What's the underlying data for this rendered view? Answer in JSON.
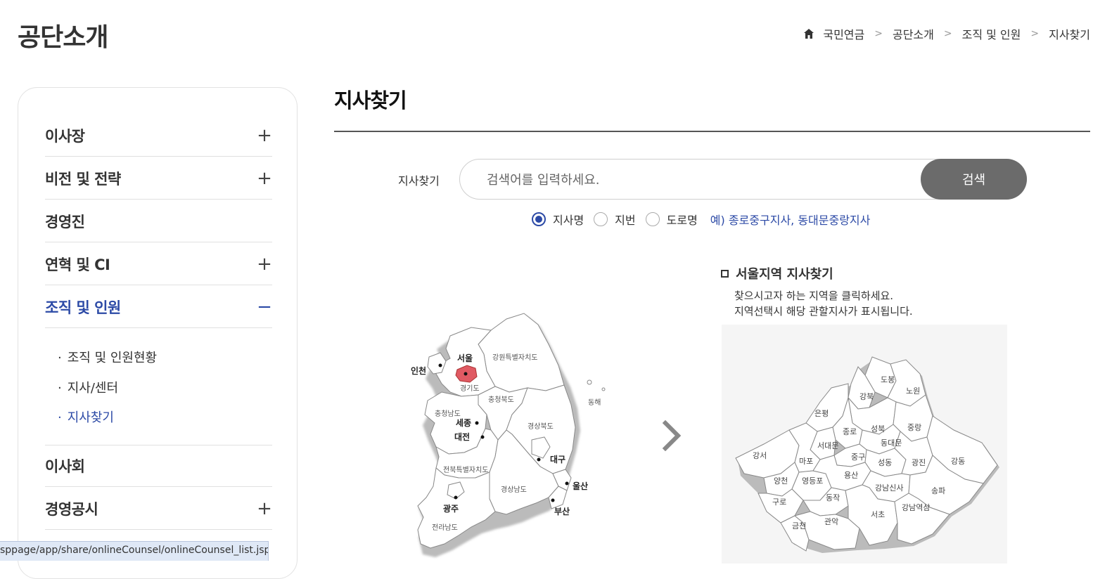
{
  "header": {
    "title": "공단소개",
    "breadcrumb": [
      "국민연금",
      "공단소개",
      "조직 및 인원",
      "지사찾기"
    ]
  },
  "sidebar": {
    "items": [
      {
        "label": "이사장",
        "toggle": "+"
      },
      {
        "label": "비전 및 전략",
        "toggle": "+"
      },
      {
        "label": "경영진",
        "toggle": ""
      },
      {
        "label": "연혁 및 CI",
        "toggle": "+"
      },
      {
        "label": "조직 및 인원",
        "toggle": "−"
      },
      {
        "label": "이사회",
        "toggle": ""
      },
      {
        "label": "경영공시",
        "toggle": "+"
      }
    ],
    "subitems": [
      "조직 및 인원현황",
      "지사/센터",
      "지사찾기"
    ],
    "bullet": "·"
  },
  "main": {
    "title": "지사찾기",
    "search": {
      "label": "지사찾기",
      "placeholder": "검색어를 입력하세요.",
      "button": "검색"
    },
    "radios": [
      {
        "label": "지사명",
        "checked": true
      },
      {
        "label": "지번",
        "checked": false
      },
      {
        "label": "도로명",
        "checked": false
      }
    ],
    "example": "예) 종로중구지사, 동대문중랑지사"
  },
  "korea_map": {
    "regions": {
      "seoul": "서울",
      "incheon": "인천",
      "gyeonggi": "경기도",
      "gangwon": "강원특별자치도",
      "chungbuk": "충청북도",
      "chungnam": "충청남도",
      "sejong": "세종",
      "daejeon": "대전",
      "gyeongbuk": "경상북도",
      "daegu": "대구",
      "jeonbuk": "전북특별자치도",
      "gyeongnam": "경상남도",
      "ulsan": "울산",
      "busan": "부산",
      "gwangju": "광주",
      "jeonnam": "전라남도",
      "donghae": "동해"
    },
    "highlight_color": "#e05a63"
  },
  "seoul_panel": {
    "title": "서울지역 지사찾기",
    "desc_line1": "찾으시고자 하는 지역을 클릭하세요.",
    "desc_line2": "지역선택시 해당 관할지사가 표시됩니다.",
    "districts": {
      "dobong": "도봉",
      "nowon": "노원",
      "gangbuk": "강북",
      "eunpyeong": "은평",
      "seongbuk": "성북",
      "jongno": "종로",
      "jungnang": "중랑",
      "seodaemun": "서대문",
      "dongdaemun": "동대문",
      "gangseo": "강서",
      "mapo": "마포",
      "jung": "중구",
      "seongdong": "성동",
      "gwangjin": "광진",
      "gangdong": "강동",
      "yangcheon": "양천",
      "yeongdeungpo": "영등포",
      "yongsan": "용산",
      "gangnam": "강남신사",
      "songpa": "송파",
      "guro": "구로",
      "dongjak": "동작",
      "seocho": "서초",
      "gangnamyeok": "강남역삼",
      "geumcheon": "금천",
      "gwanak": "관악"
    }
  },
  "status_url": "sppage/app/share/onlineCounsel/onlineCounsel_list.jsp"
}
